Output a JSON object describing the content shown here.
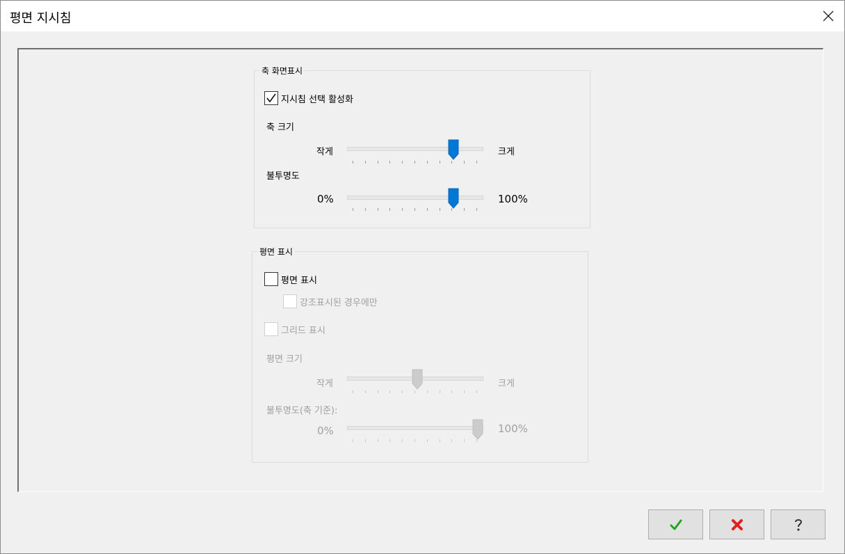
{
  "window": {
    "title": "평면 지시침"
  },
  "axis_display": {
    "group_title": "축 화면표시",
    "enable_checkbox": {
      "label": "지시침 선택 활성화",
      "checked": true
    },
    "size": {
      "label": "축 크기",
      "min_label": "작게",
      "max_label": "크게",
      "value_fraction": 0.8
    },
    "opacity": {
      "label": "불투명도",
      "min_label": "0%",
      "max_label": "100%",
      "value_fraction": 0.8
    }
  },
  "plane_display": {
    "group_title": "평면 표시",
    "show_plane_checkbox": {
      "label": "평면 표시",
      "checked": false
    },
    "highlight_only_checkbox": {
      "label": "강조표시된 경우에만",
      "checked": false,
      "enabled": false
    },
    "show_grid_checkbox": {
      "label": "그리드 표시",
      "checked": false,
      "enabled": false
    },
    "size": {
      "label": "평면 크기",
      "min_label": "작게",
      "max_label": "크게",
      "value_fraction": 0.5,
      "enabled": false
    },
    "opacity": {
      "label": "불투명도(축 기준):",
      "min_label": "0%",
      "max_label": "100%",
      "value_fraction": 1.0,
      "enabled": false
    }
  },
  "buttons": {
    "ok": {
      "icon": "checkmark-icon",
      "color": "#22a322"
    },
    "cancel": {
      "icon": "x-icon",
      "color": "#e0201c"
    },
    "help": {
      "icon": "question-icon",
      "color": "#333333"
    }
  },
  "colors": {
    "accent": "#0078d7",
    "disabled_thumb": "#cccccc"
  }
}
